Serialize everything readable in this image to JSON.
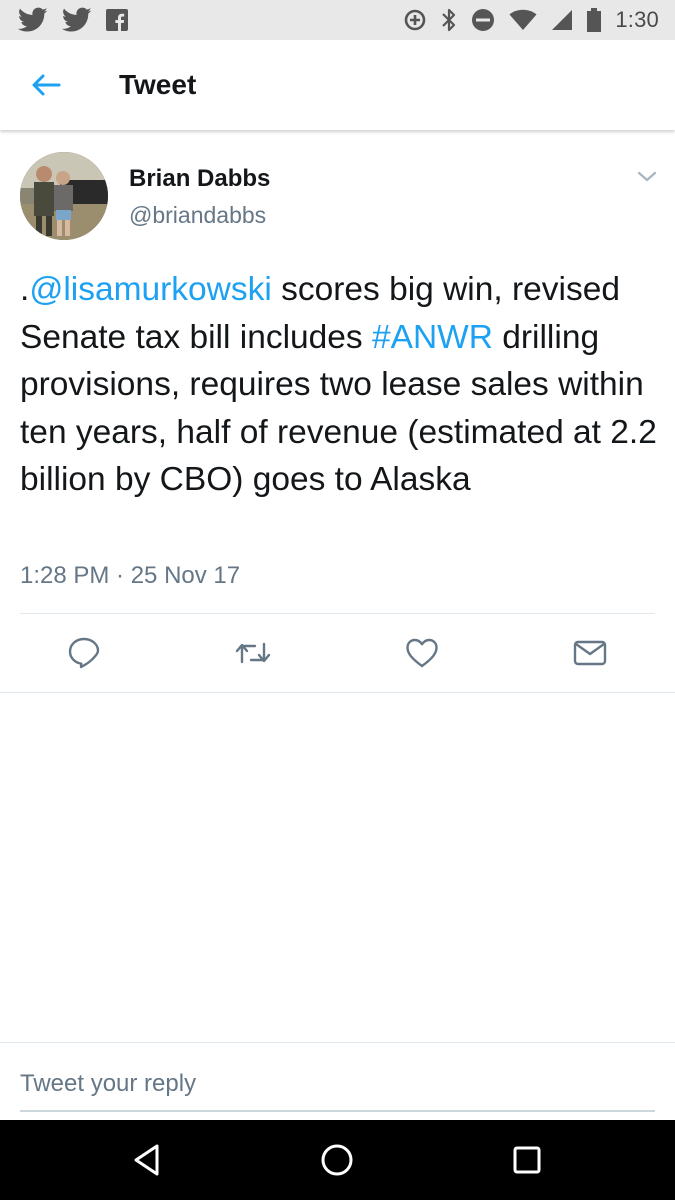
{
  "status_bar": {
    "time": "1:30",
    "left_icons": [
      "twitter-notification-icon",
      "twitter-notification-icon",
      "facebook-notification-icon"
    ],
    "right_icons": [
      "data-saver-icon",
      "bluetooth-icon",
      "do-not-disturb-icon",
      "wifi-icon",
      "cell-signal-icon",
      "battery-icon"
    ]
  },
  "header": {
    "title": "Tweet",
    "back_icon": "arrow-left-icon"
  },
  "tweet": {
    "author_name": "Brian Dabbs",
    "author_handle": "@briandabbs",
    "text_segments": [
      {
        "text": ".",
        "type": "plain"
      },
      {
        "text": "@lisamurkowski",
        "type": "mention"
      },
      {
        "text": " scores big win, revised Senate tax bill includes ",
        "type": "plain"
      },
      {
        "text": "#ANWR",
        "type": "hashtag"
      },
      {
        "text": " drilling provisions, requires two lease sales within ten years, half of revenue (estimated at 2.2 billion by CBO) goes to Alaska",
        "type": "plain"
      }
    ],
    "timestamp": "1:28 PM · 25 Nov 17",
    "actions": [
      "reply-icon",
      "retweet-icon",
      "like-icon",
      "direct-message-icon"
    ]
  },
  "reply": {
    "placeholder": "Tweet your reply"
  },
  "nav_bar": {
    "buttons": [
      "back-triangle-icon",
      "home-circle-icon",
      "recents-square-icon"
    ]
  },
  "colors": {
    "accent": "#1da1f2",
    "text": "#14171a",
    "secondary_text": "#657786",
    "status_bar_bg": "#e8e8e8",
    "nav_bar_bg": "#000000"
  }
}
